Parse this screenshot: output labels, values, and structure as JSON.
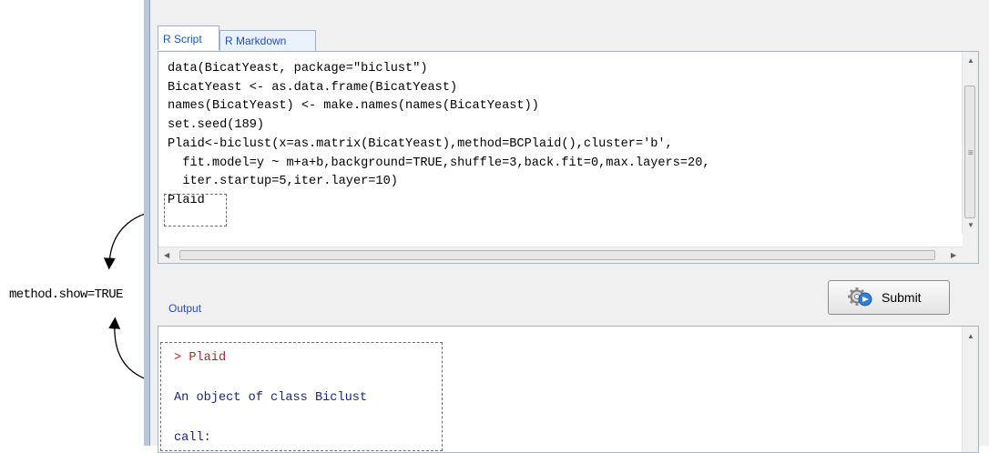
{
  "annotation": {
    "label": "method.show=TRUE"
  },
  "tabs": [
    {
      "label": "R Script",
      "active": true
    },
    {
      "label": "R Markdown",
      "active": false
    }
  ],
  "editor": {
    "lines": [
      "data(BicatYeast, package=\"biclust\")",
      "BicatYeast <- as.data.frame(BicatYeast)",
      "names(BicatYeast) <- make.names(names(BicatYeast))",
      "set.seed(189)",
      "Plaid<-biclust(x=as.matrix(BicatYeast),method=BCPlaid(),cluster='b',",
      "  fit.model=y ~ m+a+b,background=TRUE,shuffle=3,back.fit=0,max.layers=20,",
      "  iter.startup=5,iter.layer=10)",
      "Plaid"
    ]
  },
  "output": {
    "label": "Output",
    "submit_label": "Submit",
    "lines": [
      {
        "text": "> Plaid",
        "color": "#a52a2a"
      },
      {
        "text": "An object of class Biclust",
        "color": "#1a237e"
      },
      {
        "text": "call:",
        "color": "#1a237e"
      }
    ]
  },
  "scroll_glyphs": {
    "up": "▲",
    "down": "▼",
    "left": "◀",
    "right": "▶",
    "grip": "≡"
  }
}
